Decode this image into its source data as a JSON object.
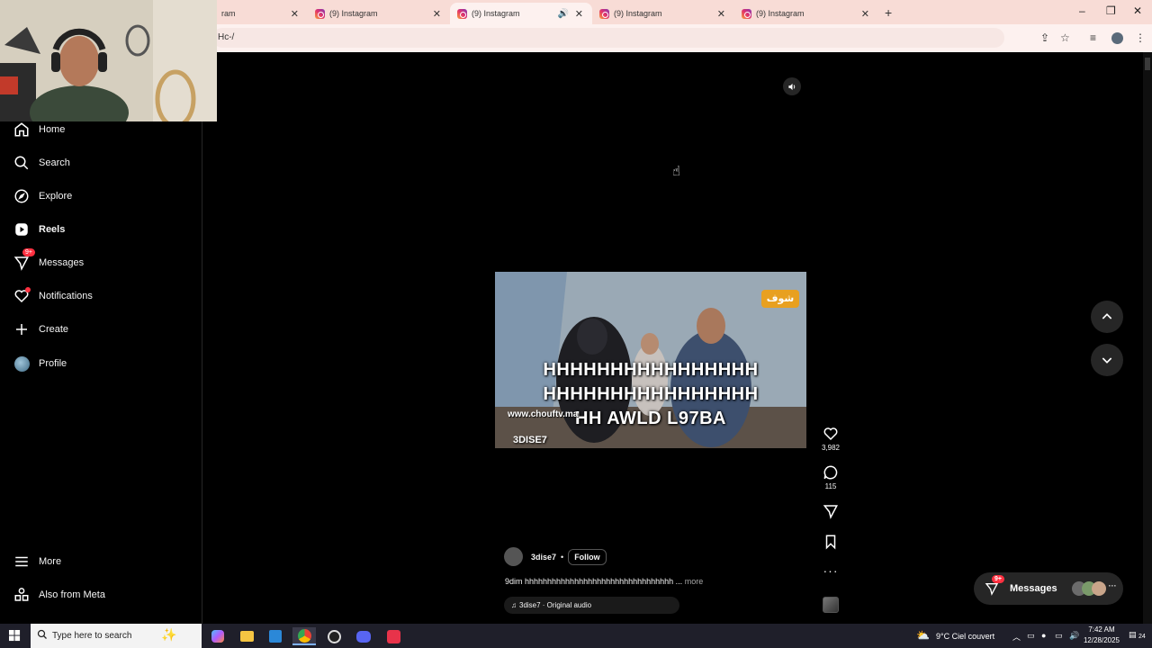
{
  "browser": {
    "tabs": [
      {
        "title": "ram",
        "active": false
      },
      {
        "title": "(9) Instagram",
        "active": false
      },
      {
        "title": "(9) Instagram",
        "active": true,
        "audio": true
      },
      {
        "title": "(9) Instagram",
        "active": false
      },
      {
        "title": "(9) Instagram",
        "active": false
      }
    ],
    "new_tab_label": "+",
    "address": "Hc-/",
    "window_controls": {
      "minimize": "–",
      "restore": "❐",
      "close": "✕"
    }
  },
  "sidebar": {
    "items": [
      {
        "label": "Home",
        "icon": "home-icon"
      },
      {
        "label": "Search",
        "icon": "search-icon"
      },
      {
        "label": "Explore",
        "icon": "compass-icon"
      },
      {
        "label": "Reels",
        "icon": "reels-icon",
        "active": true
      },
      {
        "label": "Messages",
        "icon": "send-icon",
        "badge": "9+"
      },
      {
        "label": "Notifications",
        "icon": "heart-icon",
        "dot": true
      },
      {
        "label": "Create",
        "icon": "plus-icon"
      },
      {
        "label": "Profile",
        "icon": "avatar"
      }
    ],
    "more_label": "More",
    "meta_label": "Also from Meta"
  },
  "reel": {
    "caption_overlay": [
      "HHHHHHHHHHHHHHHH",
      "HHHHHHHHHHHHHHHH",
      "HH AWLD L97BA"
    ],
    "watermark": "www.chouftv.ma",
    "handle_watermark": "3DISE7",
    "channel_logo": "شوف",
    "username": "3dise7",
    "separator": "•",
    "follow_label": "Follow",
    "caption": "9dim hhhhhhhhhhhhhhhhhhhhhhhhhhhhhhhhh ...",
    "more_label": "more",
    "audio": "3dise7 · Original audio",
    "likes": "3,982",
    "comments": "115"
  },
  "messages_pill": {
    "label": "Messages",
    "badge": "9+"
  },
  "taskbar": {
    "search_placeholder": "Type here to search",
    "weather": "9°C  Ciel couvert",
    "time": "7:42 AM",
    "date": "12/28/2025",
    "notification_count": "24"
  },
  "colors": {
    "accent_red": "#ff3040",
    "tab_bar": "#f8dcd6",
    "taskbar": "#1f1f2a"
  }
}
